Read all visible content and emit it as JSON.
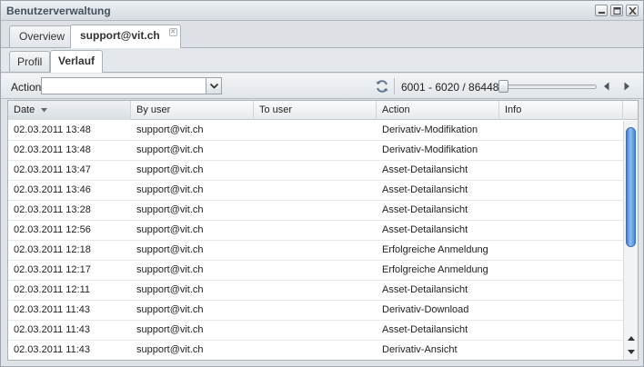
{
  "window": {
    "title": "Benutzerverwaltung"
  },
  "tabs": [
    {
      "label": "Overview"
    },
    {
      "label": "support@vit.ch"
    }
  ],
  "subtabs": [
    {
      "label": "Profil"
    },
    {
      "label": "Verlauf"
    }
  ],
  "toolbar": {
    "action_label": "Action",
    "action_value": "",
    "paging_text": "6001 - 6020 / 86448",
    "slider_position": 0.0
  },
  "grid": {
    "columns": [
      "Date",
      "By user",
      "To user",
      "Action",
      "Info"
    ],
    "sorted_column": "Date",
    "rows": [
      {
        "date": "02.03.2011 13:48",
        "by_user": "support@vit.ch",
        "to_user": "",
        "action": "Derivativ-Modifikation",
        "info": ""
      },
      {
        "date": "02.03.2011 13:48",
        "by_user": "support@vit.ch",
        "to_user": "",
        "action": "Derivativ-Modifikation",
        "info": ""
      },
      {
        "date": "02.03.2011 13:47",
        "by_user": "support@vit.ch",
        "to_user": "",
        "action": "Asset-Detailansicht",
        "info": ""
      },
      {
        "date": "02.03.2011 13:46",
        "by_user": "support@vit.ch",
        "to_user": "",
        "action": "Asset-Detailansicht",
        "info": ""
      },
      {
        "date": "02.03.2011 13:28",
        "by_user": "support@vit.ch",
        "to_user": "",
        "action": "Asset-Detailansicht",
        "info": ""
      },
      {
        "date": "02.03.2011 12:56",
        "by_user": "support@vit.ch",
        "to_user": "",
        "action": "Asset-Detailansicht",
        "info": ""
      },
      {
        "date": "02.03.2011 12:18",
        "by_user": "support@vit.ch",
        "to_user": "",
        "action": "Erfolgreiche Anmeldung",
        "info": ""
      },
      {
        "date": "02.03.2011 12:17",
        "by_user": "support@vit.ch",
        "to_user": "",
        "action": "Erfolgreiche Anmeldung",
        "info": ""
      },
      {
        "date": "02.03.2011 12:11",
        "by_user": "support@vit.ch",
        "to_user": "",
        "action": "Asset-Detailansicht",
        "info": ""
      },
      {
        "date": "02.03.2011 11:43",
        "by_user": "support@vit.ch",
        "to_user": "",
        "action": "Derivativ-Download",
        "info": ""
      },
      {
        "date": "02.03.2011 11:43",
        "by_user": "support@vit.ch",
        "to_user": "",
        "action": "Asset-Detailansicht",
        "info": ""
      },
      {
        "date": "02.03.2011 11:43",
        "by_user": "support@vit.ch",
        "to_user": "",
        "action": "Derivativ-Ansicht",
        "info": ""
      }
    ]
  },
  "icons": {
    "minimize": "minimize-icon",
    "maximize": "maximize-icon",
    "close": "close-icon",
    "tab_close": "tab-close-icon",
    "combo": "chevron-down-icon",
    "refresh": "refresh-icon",
    "prev": "triangle-left-icon",
    "next": "triangle-right-icon",
    "sort": "sort-down-icon"
  },
  "colors": {
    "scroll_thumb": "#4a86d4",
    "border": "#a9b1b9"
  }
}
